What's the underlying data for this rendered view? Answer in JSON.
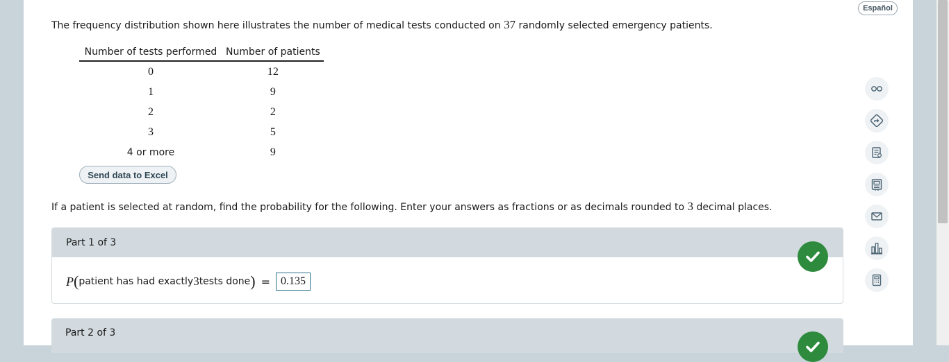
{
  "language_button": "Español",
  "intro": {
    "before": "The frequency distribution shown here illustrates the number of medical tests conducted on ",
    "count": "37",
    "after": " randomly selected emergency patients."
  },
  "table": {
    "headers": [
      "Number of tests performed",
      "Number of patients"
    ],
    "rows": [
      {
        "tests": "0",
        "patients": "12"
      },
      {
        "tests": "1",
        "patients": "9"
      },
      {
        "tests": "2",
        "patients": "2"
      },
      {
        "tests": "3",
        "patients": "5"
      },
      {
        "tests": "4 or more",
        "patients": "9"
      }
    ]
  },
  "excel_button": "Send data to Excel",
  "instructions": {
    "before": "If a patient is selected at random, find the probability for the following. Enter your answers as fractions or as decimals rounded to ",
    "places": "3",
    "after": " decimal places."
  },
  "part1": {
    "label": "Part 1 of 3",
    "P": "P",
    "text_before": "patient has had exactly ",
    "number": "3",
    "text_after": " tests done",
    "equals": "=",
    "answer": "0.135",
    "status": "correct"
  },
  "part2": {
    "label": "Part 2 of 3",
    "status": "correct"
  },
  "sidebar_icons": [
    "glasses-icon",
    "directions-icon",
    "notes-icon",
    "calculator-board-icon",
    "mail-icon",
    "bar-chart-icon",
    "calculator-icon"
  ],
  "colors": {
    "check_green": "#2e8b3e",
    "header_gray": "#d2dadf",
    "accent_teal": "#2a6f8c"
  }
}
